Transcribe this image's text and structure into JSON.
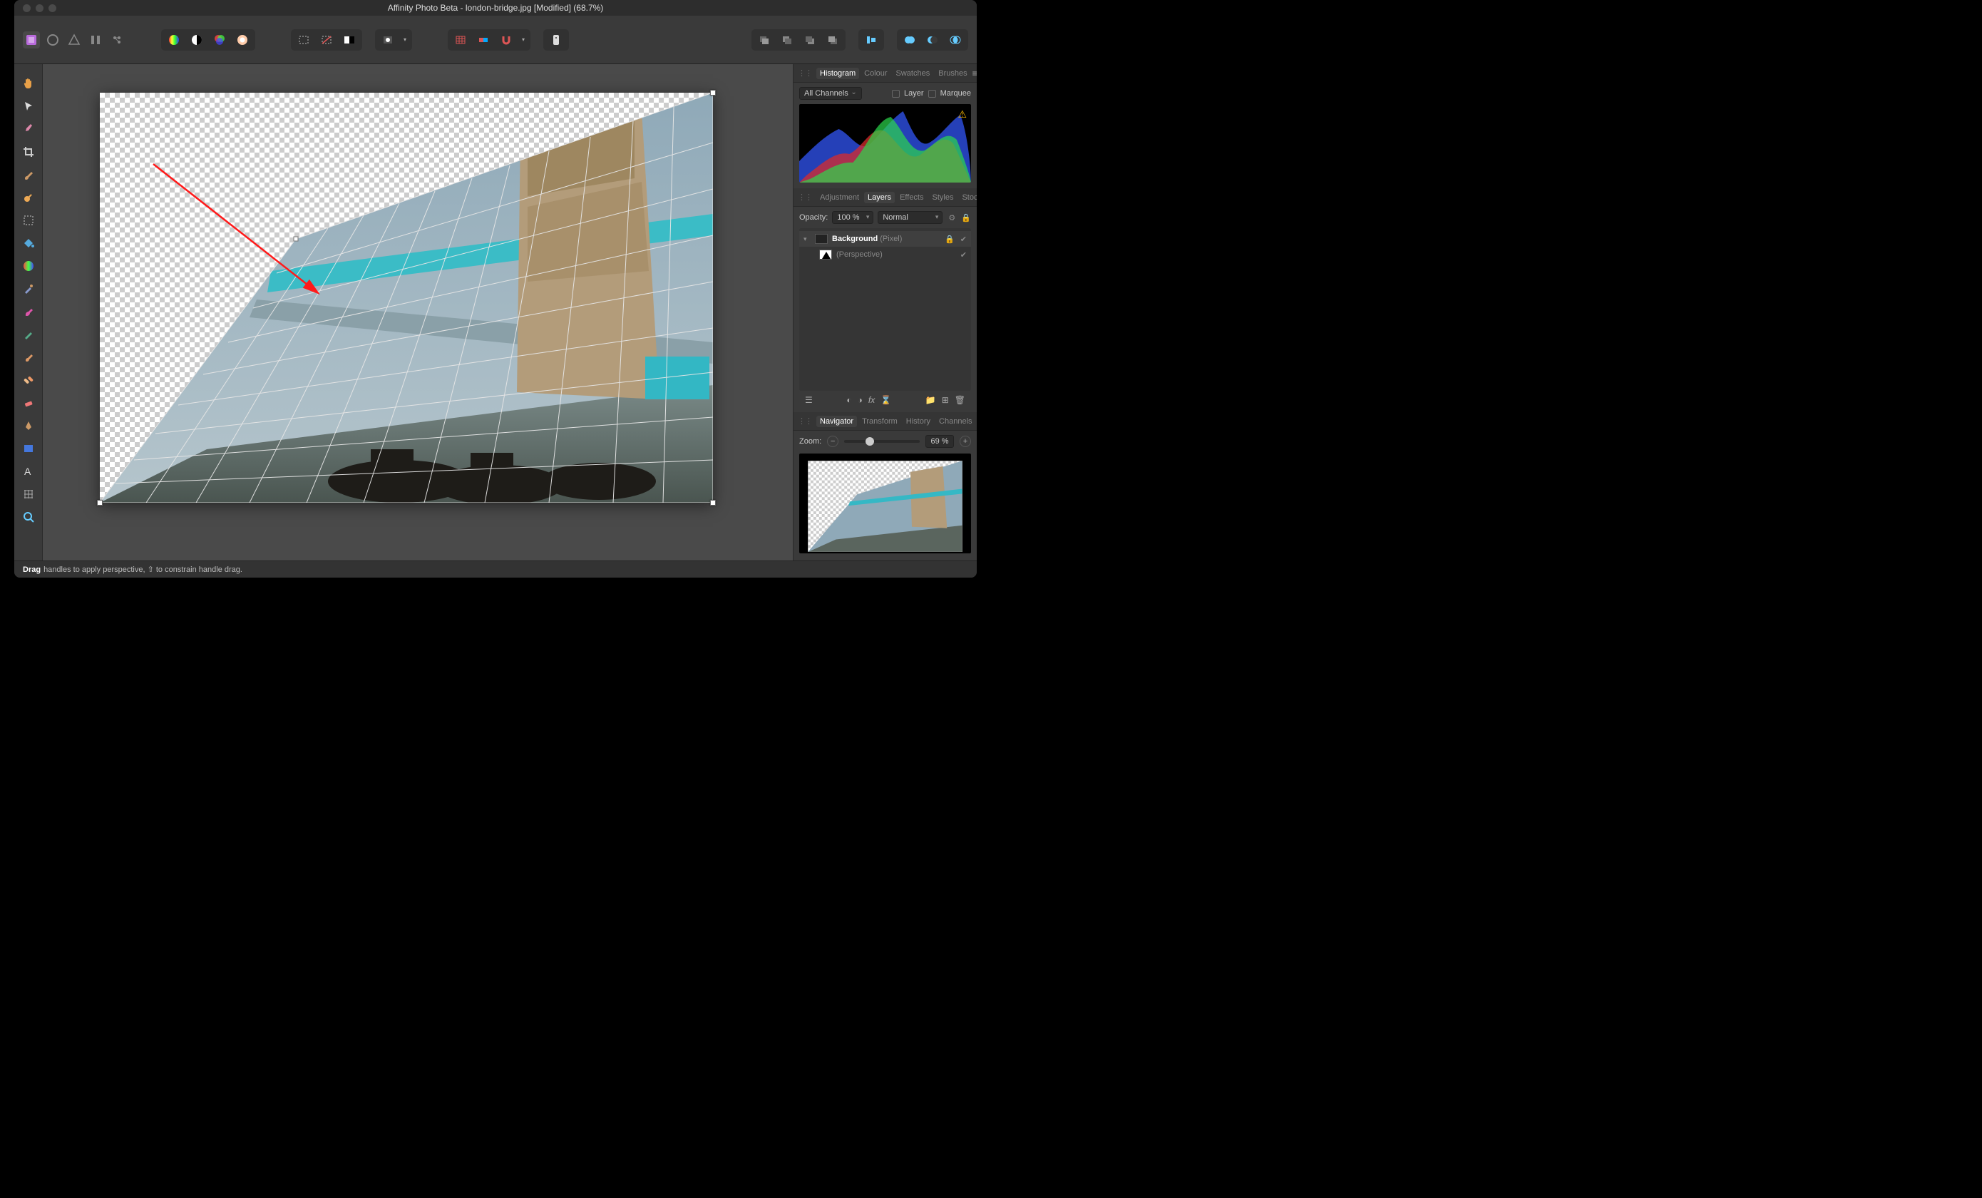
{
  "window": {
    "title": "Affinity Photo Beta - london-bridge.jpg [Modified] (68.7%)"
  },
  "toolbar": {
    "personas": [
      "photo",
      "liquify",
      "develop",
      "tone-mapping",
      "export"
    ],
    "color_group": [
      "swatches-icon",
      "greyscale-icon",
      "rgb-icon",
      "lab-icon"
    ],
    "selection_group": [
      "marquee-select-icon",
      "deselect-icon",
      "invert-pixel-icon"
    ],
    "quickmask_group": [
      "quickmask-icon"
    ],
    "snapping_group": [
      "grid-icon",
      "force-pixel-icon",
      "snapping-magnet-icon"
    ],
    "assistant_group": [
      "assistant-icon"
    ],
    "arrange_group": [
      "move-back-icon",
      "back-one-icon",
      "forward-one-icon",
      "move-front-icon"
    ],
    "align_group": [
      "align-icon"
    ],
    "boolean_group": [
      "add-icon",
      "subtract-icon",
      "intersect-icon"
    ]
  },
  "tools": [
    "hand-tool",
    "move-tool",
    "color-picker-tool",
    "crop-tool",
    "painting-brush-tool",
    "dodge-tool",
    "marquee-tool",
    "flood-fill-tool",
    "gradient-tool",
    "paint-brush-tool",
    "clone-tool",
    "mixer-brush-tool",
    "smudge-tool",
    "healing-tool",
    "erase-tool",
    "pen-tool",
    "rectangle-tool",
    "text-tool",
    "mesh-warp-tool",
    "zoom-tool"
  ],
  "status": {
    "strong": "Drag",
    "rest": " handles to apply perspective, ⇧ to constrain handle drag."
  },
  "panels": {
    "row1": {
      "tabs": [
        "Histogram",
        "Colour",
        "Swatches",
        "Brushes"
      ],
      "active": "Histogram"
    },
    "histogram": {
      "channelLabel": "All Channels",
      "layerLabel": "Layer",
      "marqueeLabel": "Marquee"
    },
    "row2": {
      "tabs": [
        "Adjustment",
        "Layers",
        "Effects",
        "Styles",
        "Stock"
      ],
      "active": "Layers"
    },
    "layers": {
      "opacityLabel": "Opacity:",
      "opacityValue": "100 %",
      "blendMode": "Normal",
      "items": [
        {
          "name": "Background",
          "type": "(Pixel)",
          "locked": true,
          "visible": true
        },
        {
          "name": "",
          "type": "(Perspective)",
          "visible": true,
          "indent": true
        }
      ]
    },
    "row3": {
      "tabs": [
        "Navigator",
        "Transform",
        "History",
        "Channels"
      ],
      "active": "Navigator"
    },
    "navigator": {
      "zoomLabel": "Zoom:",
      "zoomValue": "69 %",
      "sliderPercent": 28
    }
  }
}
